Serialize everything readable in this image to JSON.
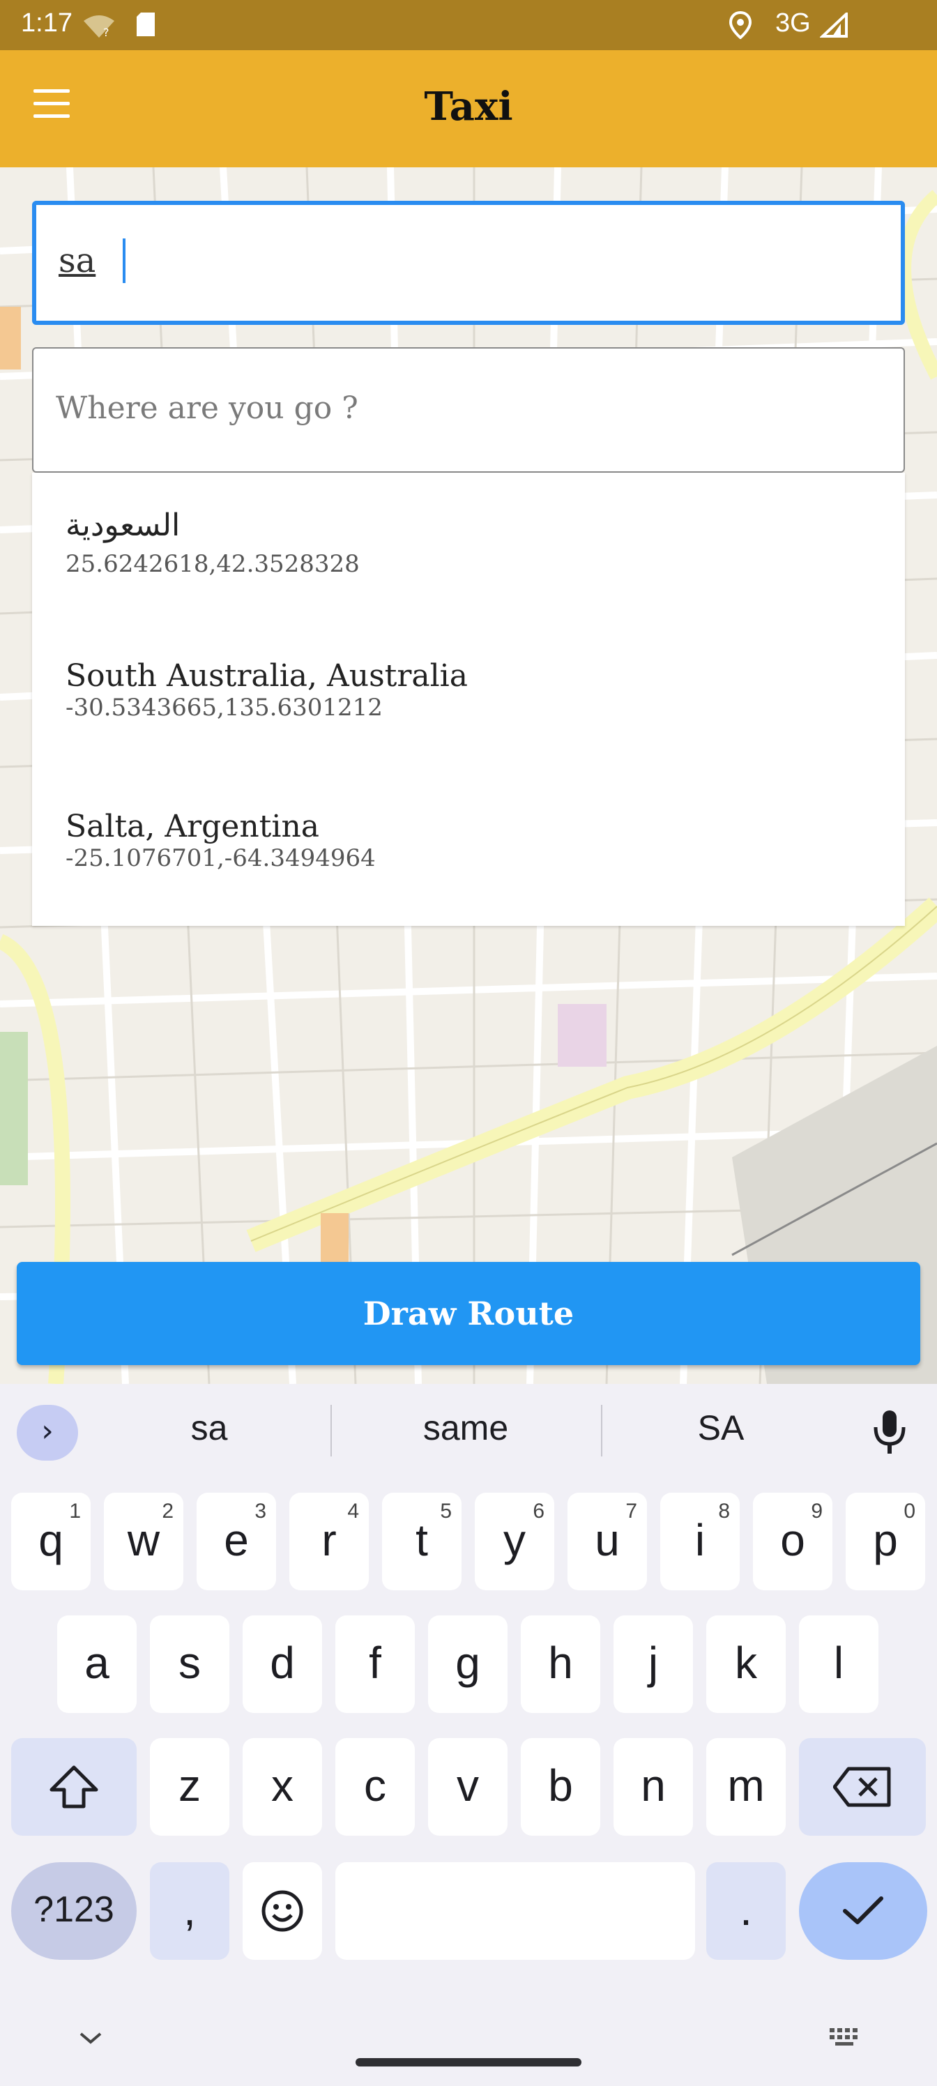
{
  "status_bar": {
    "time": "1:17",
    "network": "3G",
    "icons": [
      "wifi-question-icon",
      "sim-icon",
      "location-pin-icon",
      "cell-signal-icon"
    ]
  },
  "app_bar": {
    "title": "Taxi",
    "menu_icon": "hamburger-menu-icon"
  },
  "form": {
    "from_value": "sa",
    "to_placeholder": "Where are you go ?"
  },
  "suggestions": [
    {
      "name": "السعودية",
      "coords": "25.6242618,42.3528328"
    },
    {
      "name": "South Australia, Australia",
      "coords": "-30.5343665,135.6301212"
    },
    {
      "name": "Salta, Argentina",
      "coords": "-25.1076701,-64.3494964"
    }
  ],
  "draw_route_label": "Draw Route",
  "keyboard": {
    "suggestions": [
      "sa",
      "same",
      "SA"
    ],
    "row1": [
      {
        "k": "q",
        "n": "1"
      },
      {
        "k": "w",
        "n": "2"
      },
      {
        "k": "e",
        "n": "3"
      },
      {
        "k": "r",
        "n": "4"
      },
      {
        "k": "t",
        "n": "5"
      },
      {
        "k": "y",
        "n": "6"
      },
      {
        "k": "u",
        "n": "7"
      },
      {
        "k": "i",
        "n": "8"
      },
      {
        "k": "o",
        "n": "9"
      },
      {
        "k": "p",
        "n": "0"
      }
    ],
    "row2": [
      "a",
      "s",
      "d",
      "f",
      "g",
      "h",
      "j",
      "k",
      "l"
    ],
    "row3": [
      "z",
      "x",
      "c",
      "v",
      "b",
      "n",
      "m"
    ],
    "sym_label": "?123",
    "comma": ",",
    "period": ".",
    "colors": {
      "accent": "#2196f3",
      "app_bar": "#ecb02c",
      "status_bar": "#a97f22"
    }
  }
}
